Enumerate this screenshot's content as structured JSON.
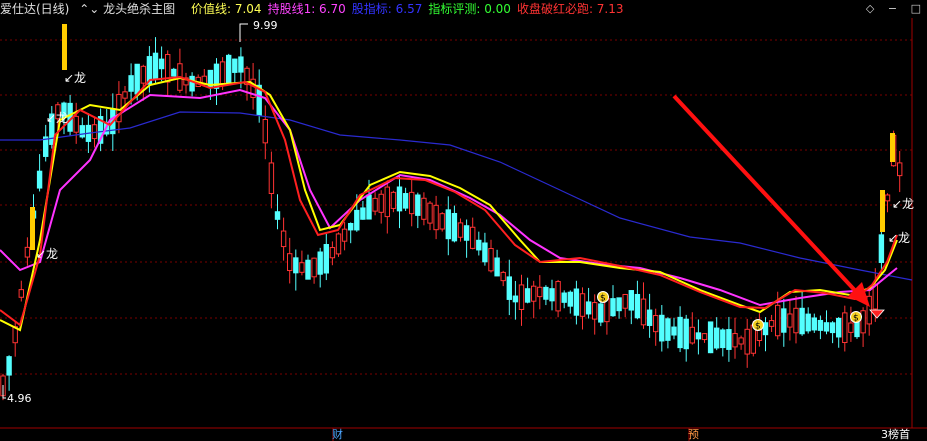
{
  "header": {
    "app_title": "爱仕达(日线)",
    "indicator_name": "龙头绝杀主图",
    "items": [
      {
        "label": "价值线:",
        "value": "7.04",
        "color": "#ffff55"
      },
      {
        "label": "持股线1:",
        "value": "6.70",
        "color": "#ff44ff"
      },
      {
        "label": "股指标:",
        "value": "6.57",
        "color": "#3333ff"
      },
      {
        "label": "指标评测:",
        "value": "0.00",
        "color": "#33ff33"
      },
      {
        "label": "收盘破红必跑:",
        "value": "7.13",
        "color": "#ff3333"
      }
    ]
  },
  "price_labels": {
    "high": "9.99",
    "low": "4.96"
  },
  "signals": {
    "long_label": "龙"
  },
  "bottom_tags": [
    {
      "text": "财",
      "color": "#4da6ff"
    },
    {
      "text": "预",
      "color": "#ff9944"
    },
    {
      "text": "3榜首",
      "color": "#ffffff"
    }
  ],
  "colors": {
    "up": "#ff3333",
    "down": "#54ffff",
    "value_line": "#ffff00",
    "hold_line": "#ff33ff",
    "index_line": "#2a2ad0",
    "fast_line": "#ff2020",
    "grid": "#7a0000"
  },
  "icons": [
    "diamond-icon",
    "minimize-icon",
    "maximize-icon"
  ]
}
